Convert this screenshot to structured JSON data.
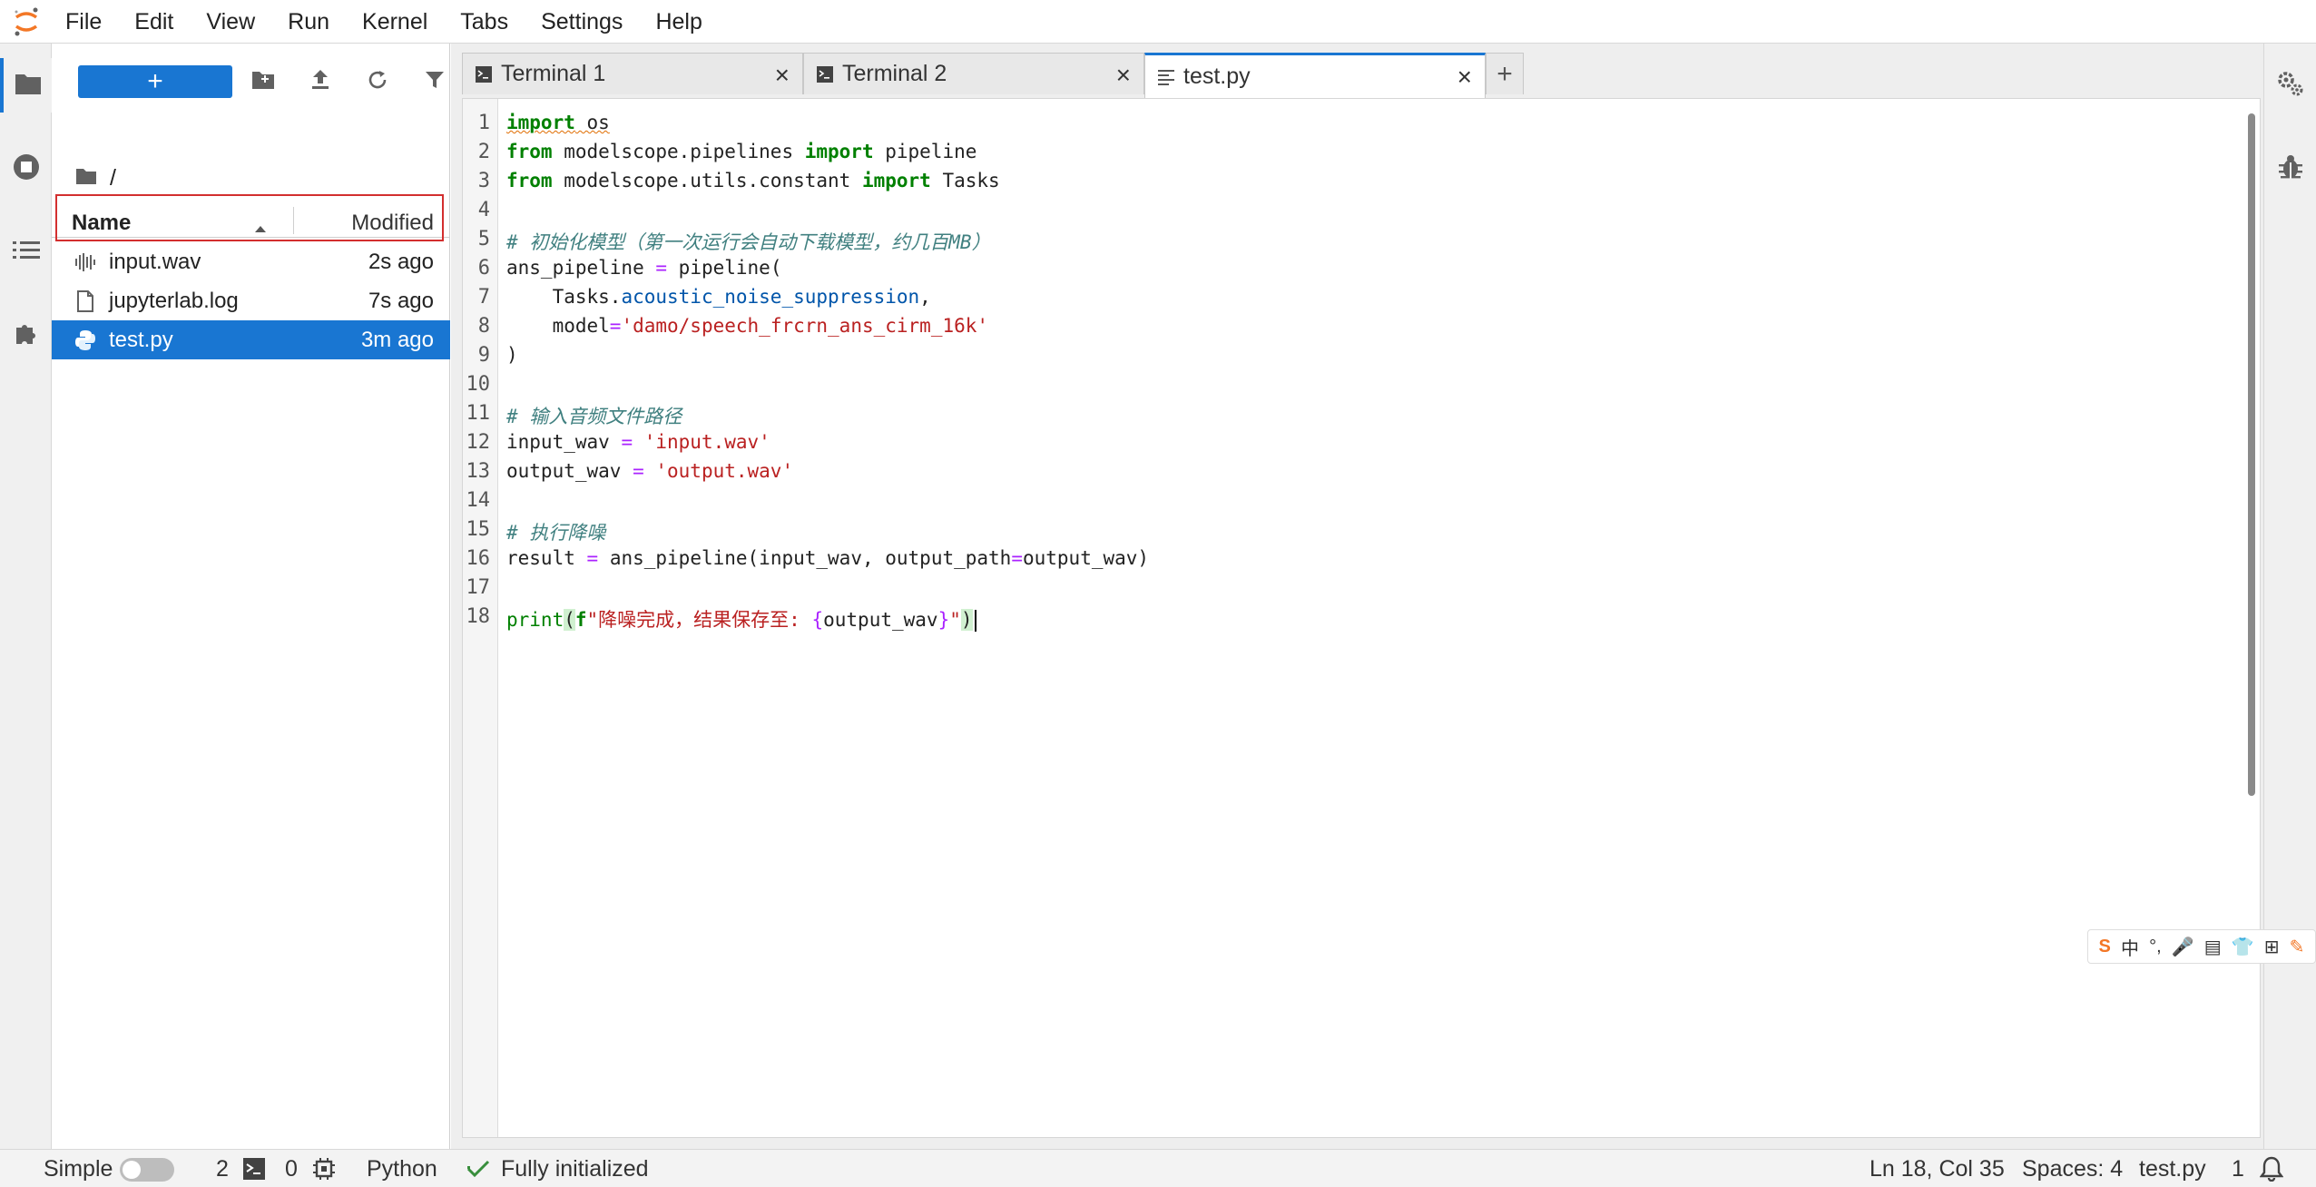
{
  "menubar": {
    "items": [
      "File",
      "Edit",
      "View",
      "Run",
      "Kernel",
      "Tabs",
      "Settings",
      "Help"
    ]
  },
  "filebrowser": {
    "new_label": "+",
    "breadcrumb": "/",
    "columns": {
      "name": "Name",
      "modified": "Modified"
    },
    "files": [
      {
        "name": "input.wav",
        "modified": "2s ago",
        "icon": "audio-file-icon"
      },
      {
        "name": "jupyterlab.log",
        "modified": "7s ago",
        "icon": "text-file-icon"
      },
      {
        "name": "test.py",
        "modified": "3m ago",
        "icon": "python-file-icon"
      }
    ]
  },
  "tabs": [
    {
      "label": "Terminal 1",
      "icon": "terminal-icon"
    },
    {
      "label": "Terminal 2",
      "icon": "terminal-icon"
    },
    {
      "label": "test.py",
      "icon": "text-editor-icon"
    }
  ],
  "editor": {
    "line_numbers": [
      "1",
      "2",
      "3",
      "4",
      "5",
      "6",
      "7",
      "8",
      "9",
      "10",
      "11",
      "12",
      "13",
      "14",
      "15",
      "16",
      "17",
      "18"
    ],
    "code": {
      "l1_kw": "import",
      "l1_rest": " os",
      "l2_kw1": "from",
      "l2_mid": " modelscope.pipelines ",
      "l2_kw2": "import",
      "l2_rest": " pipeline",
      "l3_kw1": "from",
      "l3_mid": " modelscope.utils.constant ",
      "l3_kw2": "import",
      "l3_rest": " Tasks",
      "l5": "# 初始化模型（第一次运行会自动下载模型，约几百MB）",
      "l6_a": "ans_pipeline ",
      "l6_op": "=",
      "l6_b": " pipeline(",
      "l7_a": "    Tasks.",
      "l7_attr": "acoustic_noise_suppression",
      "l7_b": ",",
      "l8_a": "    model",
      "l8_op": "=",
      "l8_str": "'damo/speech_frcrn_ans_cirm_16k'",
      "l9": ")",
      "l11": "# 输入音频文件路径",
      "l12_a": "input_wav ",
      "l12_op": "=",
      "l12_str": " 'input.wav'",
      "l13_a": "output_wav ",
      "l13_op": "=",
      "l13_str": " 'output.wav'",
      "l15": "# 执行降噪",
      "l16_a": "result ",
      "l16_op": "=",
      "l16_b": " ans_pipeline(input_wav, output_path",
      "l16_op2": "=",
      "l16_c": "output_wav)",
      "l18_fn": "print",
      "l18_paren": "(",
      "l18_f": "f",
      "l18_str1": "\"降噪完成，结果保存至: ",
      "l18_b1": "{",
      "l18_var": "output_wav",
      "l18_b2": "}",
      "l18_str2": "\"",
      "l18_close": ")"
    }
  },
  "ime": [
    "S",
    "中",
    "°,",
    "🎤",
    "▤",
    "👕",
    "⊞",
    "✎"
  ],
  "statusbar": {
    "mode": "Simple",
    "terminals_count": "2",
    "kernels_count": "0",
    "kernel_name": "Python",
    "kernel_status": "Fully initialized",
    "cursor_pos": "Ln 18, Col 35",
    "spaces": "Spaces: 4",
    "filename": "test.py",
    "notifications": "1"
  },
  "colors": {
    "accent": "#1976d2",
    "highlight": "#d32f2f",
    "logo": "#f37726"
  }
}
